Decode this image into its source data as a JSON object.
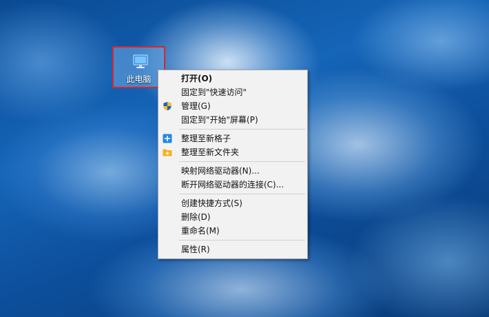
{
  "desktop": {
    "icon": {
      "label": "此电脑",
      "icon_name": "computer-icon",
      "selection_border_color": "#d9252f"
    }
  },
  "context_menu": {
    "groups": [
      [
        {
          "label": "打开(O)",
          "bold": true,
          "icon": null
        },
        {
          "label": "固定到\"快速访问\"",
          "bold": false,
          "icon": null
        },
        {
          "label": "管理(G)",
          "bold": false,
          "icon": "uac-shield-icon"
        },
        {
          "label": "固定到\"开始\"屏幕(P)",
          "bold": false,
          "icon": null
        }
      ],
      [
        {
          "label": "整理至新格子",
          "bold": false,
          "icon": "new-grid-icon"
        },
        {
          "label": "整理至新文件夹",
          "bold": false,
          "icon": "new-folder-icon"
        }
      ],
      [
        {
          "label": "映射网络驱动器(N)...",
          "bold": false,
          "icon": null
        },
        {
          "label": "断开网络驱动器的连接(C)...",
          "bold": false,
          "icon": null
        }
      ],
      [
        {
          "label": "创建快捷方式(S)",
          "bold": false,
          "icon": null
        },
        {
          "label": "删除(D)",
          "bold": false,
          "icon": null
        },
        {
          "label": "重命名(M)",
          "bold": false,
          "icon": null
        }
      ],
      [
        {
          "label": "属性(R)",
          "bold": false,
          "icon": null
        }
      ]
    ]
  }
}
